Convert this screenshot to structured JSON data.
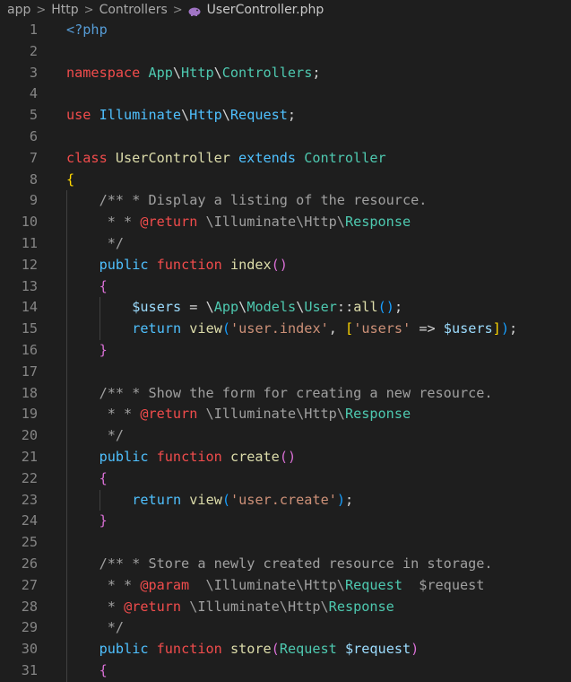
{
  "breadcrumb": {
    "items": [
      "app",
      "Http",
      "Controllers"
    ],
    "current_file": "UserController.php",
    "file_icon": "php-elephant-icon"
  },
  "editor": {
    "language": "php",
    "lines": [
      {
        "n": "1",
        "indent": 0,
        "tokens": [
          {
            "t": "<?php",
            "c": "tg"
          }
        ]
      },
      {
        "n": "2",
        "indent": 0,
        "tokens": []
      },
      {
        "n": "3",
        "indent": 0,
        "tokens": [
          {
            "t": "namespace ",
            "c": "kw"
          },
          {
            "t": "App",
            "c": "ty"
          },
          {
            "t": "\\",
            "c": "df"
          },
          {
            "t": "Http",
            "c": "ty"
          },
          {
            "t": "\\",
            "c": "df"
          },
          {
            "t": "Controllers",
            "c": "ty"
          },
          {
            "t": ";",
            "c": "df"
          }
        ]
      },
      {
        "n": "4",
        "indent": 0,
        "tokens": []
      },
      {
        "n": "5",
        "indent": 0,
        "tokens": [
          {
            "t": "use ",
            "c": "kw"
          },
          {
            "t": "Illuminate",
            "c": "kw2"
          },
          {
            "t": "\\",
            "c": "df"
          },
          {
            "t": "Http",
            "c": "kw2"
          },
          {
            "t": "\\",
            "c": "df"
          },
          {
            "t": "Request",
            "c": "kw2"
          },
          {
            "t": ";",
            "c": "df"
          }
        ]
      },
      {
        "n": "6",
        "indent": 0,
        "tokens": []
      },
      {
        "n": "7",
        "indent": 0,
        "tokens": [
          {
            "t": "class ",
            "c": "kw"
          },
          {
            "t": "UserController",
            "c": "fn"
          },
          {
            "t": " extends ",
            "c": "kw2"
          },
          {
            "t": "Controller",
            "c": "ty"
          }
        ]
      },
      {
        "n": "8",
        "indent": 0,
        "tokens": [
          {
            "t": "{",
            "c": "b1"
          }
        ]
      },
      {
        "n": "9",
        "indent": 1,
        "tokens": [
          {
            "t": "/** * Display a listing of the resource.",
            "c": "cm"
          }
        ]
      },
      {
        "n": "10",
        "indent": 1,
        "tokens": [
          {
            "t": " * * ",
            "c": "cm"
          },
          {
            "t": "@return",
            "c": "kw"
          },
          {
            "t": " \\Illuminate\\Http\\",
            "c": "cm"
          },
          {
            "t": "Response",
            "c": "ty"
          }
        ]
      },
      {
        "n": "11",
        "indent": 1,
        "tokens": [
          {
            "t": " */",
            "c": "cm"
          }
        ]
      },
      {
        "n": "12",
        "indent": 1,
        "tokens": [
          {
            "t": "public ",
            "c": "kw2"
          },
          {
            "t": "function ",
            "c": "kw"
          },
          {
            "t": "index",
            "c": "fn"
          },
          {
            "t": "()",
            "c": "b2"
          }
        ]
      },
      {
        "n": "13",
        "indent": 1,
        "tokens": [
          {
            "t": "{",
            "c": "b2"
          }
        ]
      },
      {
        "n": "14",
        "indent": 2,
        "tokens": [
          {
            "t": "$users",
            "c": "vr"
          },
          {
            "t": " = \\",
            "c": "df"
          },
          {
            "t": "App",
            "c": "ty"
          },
          {
            "t": "\\",
            "c": "df"
          },
          {
            "t": "Models",
            "c": "ty"
          },
          {
            "t": "\\",
            "c": "df"
          },
          {
            "t": "User",
            "c": "ty"
          },
          {
            "t": "::",
            "c": "df"
          },
          {
            "t": "all",
            "c": "fn"
          },
          {
            "t": "()",
            "c": "b3"
          },
          {
            "t": ";",
            "c": "df"
          }
        ]
      },
      {
        "n": "15",
        "indent": 2,
        "tokens": [
          {
            "t": "return ",
            "c": "kw2"
          },
          {
            "t": "view",
            "c": "fn"
          },
          {
            "t": "(",
            "c": "b3"
          },
          {
            "t": "'user.index'",
            "c": "st"
          },
          {
            "t": ", ",
            "c": "df"
          },
          {
            "t": "[",
            "c": "b1"
          },
          {
            "t": "'users'",
            "c": "st"
          },
          {
            "t": " => ",
            "c": "df"
          },
          {
            "t": "$users",
            "c": "vr"
          },
          {
            "t": "]",
            "c": "b1"
          },
          {
            "t": ")",
            "c": "b3"
          },
          {
            "t": ";",
            "c": "df"
          }
        ]
      },
      {
        "n": "16",
        "indent": 1,
        "tokens": [
          {
            "t": "}",
            "c": "b2"
          }
        ]
      },
      {
        "n": "17",
        "indent": 1,
        "tokens": []
      },
      {
        "n": "18",
        "indent": 1,
        "tokens": [
          {
            "t": "/** * Show the form for creating a new resource.",
            "c": "cm"
          }
        ]
      },
      {
        "n": "19",
        "indent": 1,
        "tokens": [
          {
            "t": " * * ",
            "c": "cm"
          },
          {
            "t": "@return",
            "c": "kw"
          },
          {
            "t": " \\Illuminate\\Http\\",
            "c": "cm"
          },
          {
            "t": "Response",
            "c": "ty"
          }
        ]
      },
      {
        "n": "20",
        "indent": 1,
        "tokens": [
          {
            "t": " */",
            "c": "cm"
          }
        ]
      },
      {
        "n": "21",
        "indent": 1,
        "tokens": [
          {
            "t": "public ",
            "c": "kw2"
          },
          {
            "t": "function ",
            "c": "kw"
          },
          {
            "t": "create",
            "c": "fn"
          },
          {
            "t": "()",
            "c": "b2"
          }
        ]
      },
      {
        "n": "22",
        "indent": 1,
        "tokens": [
          {
            "t": "{",
            "c": "b2"
          }
        ]
      },
      {
        "n": "23",
        "indent": 2,
        "tokens": [
          {
            "t": "return ",
            "c": "kw2"
          },
          {
            "t": "view",
            "c": "fn"
          },
          {
            "t": "(",
            "c": "b3"
          },
          {
            "t": "'user.create'",
            "c": "st"
          },
          {
            "t": ")",
            "c": "b3"
          },
          {
            "t": ";",
            "c": "df"
          }
        ]
      },
      {
        "n": "24",
        "indent": 1,
        "tokens": [
          {
            "t": "}",
            "c": "b2"
          }
        ]
      },
      {
        "n": "25",
        "indent": 1,
        "tokens": []
      },
      {
        "n": "26",
        "indent": 1,
        "tokens": [
          {
            "t": "/** * Store a newly created resource in storage.",
            "c": "cm"
          }
        ]
      },
      {
        "n": "27",
        "indent": 1,
        "tokens": [
          {
            "t": " * * ",
            "c": "cm"
          },
          {
            "t": "@param",
            "c": "kw"
          },
          {
            "t": "  \\Illuminate\\Http\\",
            "c": "cm"
          },
          {
            "t": "Request",
            "c": "ty"
          },
          {
            "t": "  $request",
            "c": "cm"
          }
        ]
      },
      {
        "n": "28",
        "indent": 1,
        "tokens": [
          {
            "t": " * ",
            "c": "cm"
          },
          {
            "t": "@return",
            "c": "kw"
          },
          {
            "t": " \\Illuminate\\Http\\",
            "c": "cm"
          },
          {
            "t": "Response",
            "c": "ty"
          }
        ]
      },
      {
        "n": "29",
        "indent": 1,
        "tokens": [
          {
            "t": " */",
            "c": "cm"
          }
        ]
      },
      {
        "n": "30",
        "indent": 1,
        "tokens": [
          {
            "t": "public ",
            "c": "kw2"
          },
          {
            "t": "function ",
            "c": "kw"
          },
          {
            "t": "store",
            "c": "fn"
          },
          {
            "t": "(",
            "c": "b2"
          },
          {
            "t": "Request",
            "c": "ty"
          },
          {
            "t": " $request",
            "c": "vr"
          },
          {
            "t": ")",
            "c": "b2"
          }
        ]
      },
      {
        "n": "31",
        "indent": 1,
        "tokens": [
          {
            "t": "{",
            "c": "b2"
          }
        ]
      }
    ]
  }
}
